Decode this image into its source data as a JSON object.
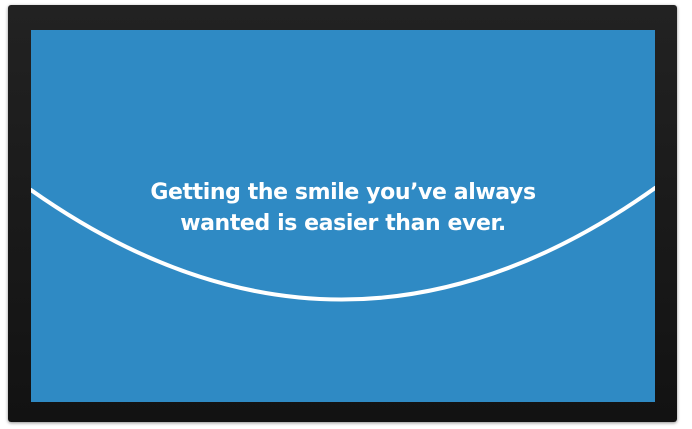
{
  "screen": {
    "background_color": "#2f8ac4",
    "smile_color": "#ffffff",
    "headline_lines": [
      "Getting the smile you’ve always",
      "wanted is easier than ever."
    ]
  },
  "frame": {
    "color": "#1a1a1a"
  }
}
